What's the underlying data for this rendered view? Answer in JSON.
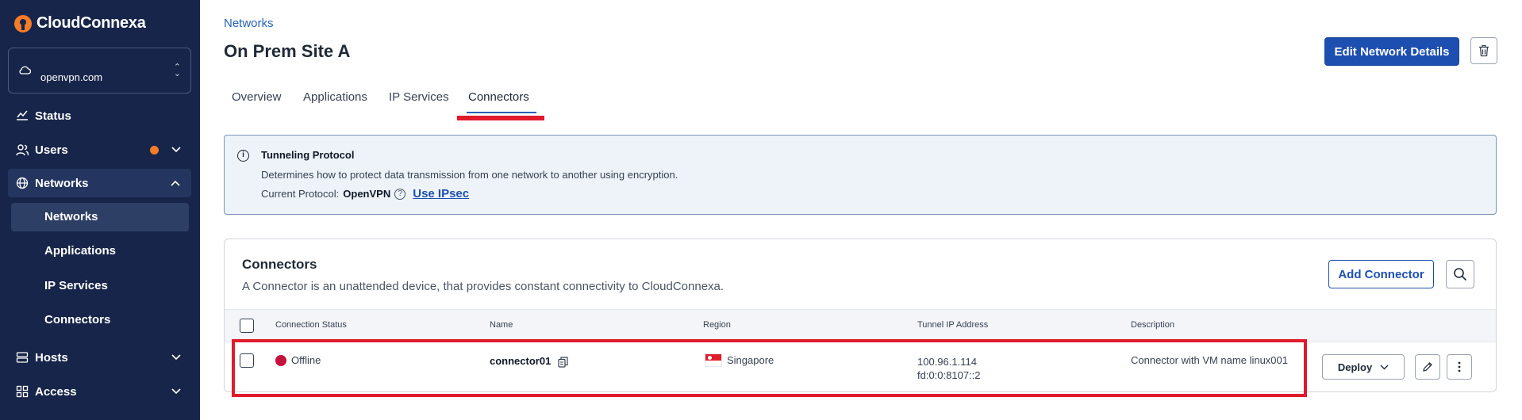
{
  "brand": {
    "name": "CloudConnexa"
  },
  "org_selector": {
    "value": "openvpn.com"
  },
  "sidebar": {
    "items": [
      {
        "label": "Status"
      },
      {
        "label": "Users"
      },
      {
        "label": "Networks"
      },
      {
        "label": "Hosts"
      },
      {
        "label": "Access"
      }
    ],
    "networks_sub": [
      {
        "label": "Networks"
      },
      {
        "label": "Applications"
      },
      {
        "label": "IP Services"
      },
      {
        "label": "Connectors"
      }
    ]
  },
  "header": {
    "breadcrumb": "Networks",
    "title": "On Prem Site A",
    "edit_button": "Edit Network Details"
  },
  "tabs": [
    {
      "label": "Overview"
    },
    {
      "label": "Applications"
    },
    {
      "label": "IP Services"
    },
    {
      "label": "Connectors",
      "active": true
    }
  ],
  "info": {
    "title": "Tunneling Protocol",
    "description": "Determines how to protect data transmission from one network to another using encryption.",
    "protocol_label": "Current Protocol:",
    "protocol_value": "OpenVPN",
    "switch_link": "Use IPsec"
  },
  "connectors_card": {
    "title": "Connectors",
    "description": "A Connector is an unattended device, that provides constant connectivity to CloudConnexa.",
    "add_button": "Add Connector",
    "columns": [
      "Connection Status",
      "Name",
      "Region",
      "Tunnel IP Address",
      "Description"
    ],
    "rows": [
      {
        "status": "Offline",
        "name": "connector01",
        "region": "Singapore",
        "tunnel_ipv4": "100.96.1.114",
        "tunnel_ipv6": "fd:0:0:8107::2",
        "description": "Connector with VM name linux001",
        "deploy_button": "Deploy"
      }
    ]
  },
  "colors": {
    "sidebar_bg": "#17254a",
    "primary": "#1d4fb1",
    "offline": "#c4123c",
    "highlight": "#e01b2d",
    "notification_dot": "#f57c28"
  }
}
